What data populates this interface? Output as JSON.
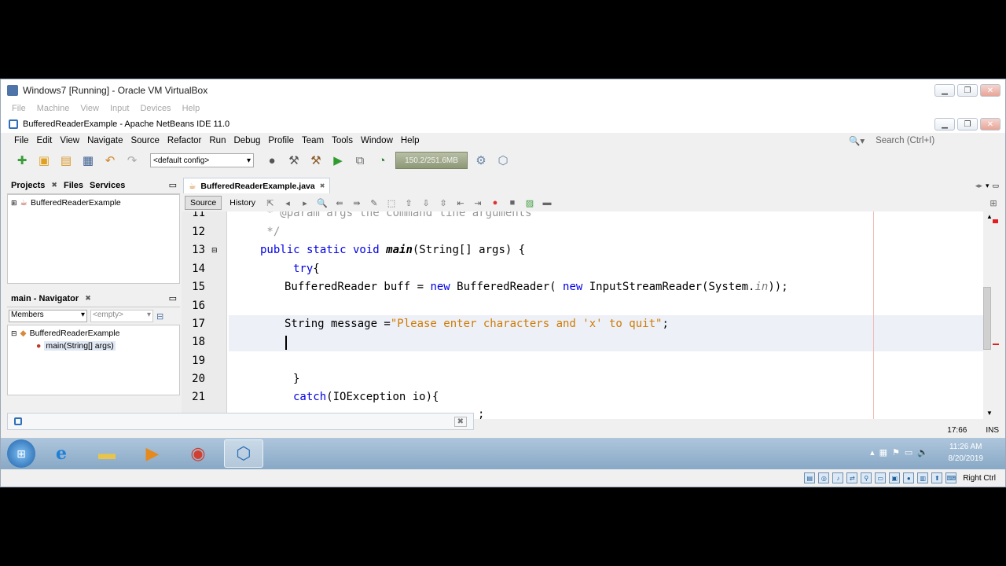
{
  "vm_window": {
    "title": "Windows7 [Running] - Oracle VM VirtualBox",
    "menu": [
      "File",
      "Machine",
      "View",
      "Input",
      "Devices",
      "Help"
    ],
    "status_host_key": "Right Ctrl"
  },
  "netbeans": {
    "title": "BufferedReaderExample - Apache NetBeans IDE 11.0",
    "menu": [
      "File",
      "Edit",
      "View",
      "Navigate",
      "Source",
      "Refactor",
      "Run",
      "Debug",
      "Profile",
      "Team",
      "Tools",
      "Window",
      "Help"
    ],
    "search_placeholder": "Search (Ctrl+I)",
    "config": "<default config>",
    "memory": "150.2/251.6MB"
  },
  "projects_panel": {
    "tabs": [
      "Projects",
      "Files",
      "Services"
    ],
    "tree": [
      "BufferedReaderExample"
    ]
  },
  "navigator_panel": {
    "title": "main - Navigator",
    "filter": "Members",
    "filter2": "<empty>",
    "tree": [
      "BufferedReaderExample",
      "main(String[] args)"
    ]
  },
  "editor": {
    "tab": "BufferedReaderExample.java",
    "source_tab": "Source",
    "history_tab": "History",
    "line_numbers": [
      "11",
      "12",
      "13",
      "14",
      "15",
      "16",
      "17",
      "18",
      "19",
      "20",
      "21"
    ],
    "lines": {
      "l11": " * @param args the command line arguments",
      "l12": " */",
      "l13_kw": "public static void ",
      "l13_fn": "main",
      "l13_rest": "(String[] args) {",
      "l14_kw": "try",
      "l14_rest": "{",
      "l15_a": "BufferedReader buff = ",
      "l15_kw1": "new",
      "l15_b": " BufferedReader( ",
      "l15_kw2": "new",
      "l15_c": " InputStreamReader(System.",
      "l15_in": "in",
      "l15_d": "));",
      "l17_a": "String message =",
      "l17_str": "\"Please enter characters and 'x' to quit\"",
      "l17_b": ";",
      "l20": "}",
      "l21_kw": "catch",
      "l21_rest": "(IOException io){",
      "l22": ";"
    },
    "caret_pos": "17:66",
    "insert_mode": "INS"
  },
  "taskbar": {
    "time": "11:26 AM",
    "date": "8/20/2019"
  },
  "colors": {
    "keyword": "#0000e6",
    "string": "#ce7b00",
    "comment": "#969696",
    "taskbar": "#9db8d2"
  }
}
